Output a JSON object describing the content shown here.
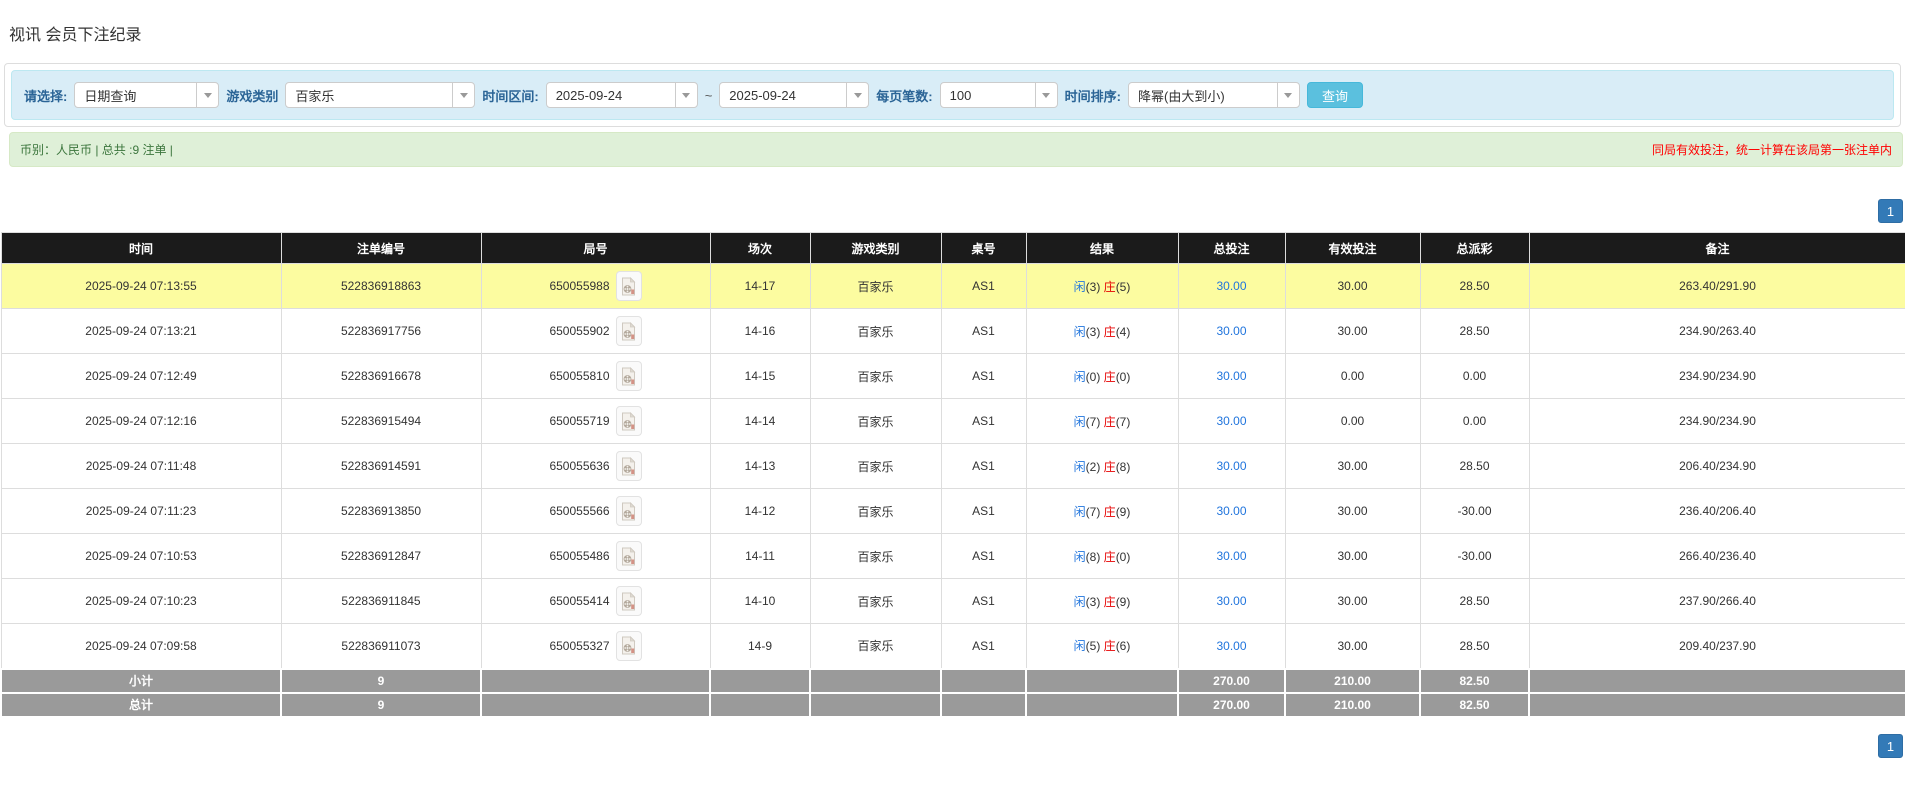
{
  "page": {
    "title": "视讯 会员下注纪录"
  },
  "filters": {
    "select_label": "请选择:",
    "select_value": "日期查询",
    "game_type_label": "游戏类别",
    "game_type_value": "百家乐",
    "time_range_label": "时间区间:",
    "date_from": "2025-09-24",
    "range_separator": "~",
    "date_to": "2025-09-24",
    "page_size_label": "每页笔数:",
    "page_size_value": "100",
    "sort_label": "时间排序:",
    "sort_value": "降幂(由大到小)",
    "search_button": "查询"
  },
  "summary": {
    "left_text": "币别：人民币 | 总共 :9 注单 |",
    "right_notice": "同局有效投注，统一计算在该局第一张注单内"
  },
  "pagination": {
    "page": "1"
  },
  "colors": {
    "link_blue": "#2175dd",
    "negative_red": "#e60000",
    "highlight_yellow": "#fcfca0",
    "header_bg": "#1b1b1b",
    "pager_blue": "#337ab7"
  },
  "table": {
    "headers": [
      "时间",
      "注单编号",
      "局号",
      "场次",
      "游戏类别",
      "桌号",
      "结果",
      "总投注",
      "有效投注",
      "总派彩",
      "备注"
    ],
    "rows": [
      {
        "highlight": true,
        "time": "2025-09-24 07:13:55",
        "bet_id": "522836918863",
        "round_id": "650055988",
        "session": "14-17",
        "game": "百家乐",
        "table": "AS1",
        "result": {
          "player_label": "闲",
          "player_count": "(3)",
          "banker_label": "庄",
          "banker_count": "(5)"
        },
        "total_bet": "30.00",
        "valid_bet": "30.00",
        "payout": "28.50",
        "payout_negative": false,
        "remark": "263.40/291.90"
      },
      {
        "highlight": false,
        "time": "2025-09-24 07:13:21",
        "bet_id": "522836917756",
        "round_id": "650055902",
        "session": "14-16",
        "game": "百家乐",
        "table": "AS1",
        "result": {
          "player_label": "闲",
          "player_count": "(3)",
          "banker_label": "庄",
          "banker_count": "(4)"
        },
        "total_bet": "30.00",
        "valid_bet": "30.00",
        "payout": "28.50",
        "payout_negative": false,
        "remark": "234.90/263.40"
      },
      {
        "highlight": false,
        "time": "2025-09-24 07:12:49",
        "bet_id": "522836916678",
        "round_id": "650055810",
        "session": "14-15",
        "game": "百家乐",
        "table": "AS1",
        "result": {
          "player_label": "闲",
          "player_count": "(0)",
          "banker_label": "庄",
          "banker_count": "(0)"
        },
        "total_bet": "30.00",
        "valid_bet": "0.00",
        "payout": "0.00",
        "payout_negative": false,
        "remark": "234.90/234.90"
      },
      {
        "highlight": false,
        "time": "2025-09-24 07:12:16",
        "bet_id": "522836915494",
        "round_id": "650055719",
        "session": "14-14",
        "game": "百家乐",
        "table": "AS1",
        "result": {
          "player_label": "闲",
          "player_count": "(7)",
          "banker_label": "庄",
          "banker_count": "(7)"
        },
        "total_bet": "30.00",
        "valid_bet": "0.00",
        "payout": "0.00",
        "payout_negative": false,
        "remark": "234.90/234.90"
      },
      {
        "highlight": false,
        "time": "2025-09-24 07:11:48",
        "bet_id": "522836914591",
        "round_id": "650055636",
        "session": "14-13",
        "game": "百家乐",
        "table": "AS1",
        "result": {
          "player_label": "闲",
          "player_count": "(2)",
          "banker_label": "庄",
          "banker_count": "(8)"
        },
        "total_bet": "30.00",
        "valid_bet": "30.00",
        "payout": "28.50",
        "payout_negative": false,
        "remark": "206.40/234.90"
      },
      {
        "highlight": false,
        "time": "2025-09-24 07:11:23",
        "bet_id": "522836913850",
        "round_id": "650055566",
        "session": "14-12",
        "game": "百家乐",
        "table": "AS1",
        "result": {
          "player_label": "闲",
          "player_count": "(7)",
          "banker_label": "庄",
          "banker_count": "(9)"
        },
        "total_bet": "30.00",
        "valid_bet": "30.00",
        "payout": "-30.00",
        "payout_negative": true,
        "remark": "236.40/206.40"
      },
      {
        "highlight": false,
        "time": "2025-09-24 07:10:53",
        "bet_id": "522836912847",
        "round_id": "650055486",
        "session": "14-11",
        "game": "百家乐",
        "table": "AS1",
        "result": {
          "player_label": "闲",
          "player_count": "(8)",
          "banker_label": "庄",
          "banker_count": "(0)"
        },
        "total_bet": "30.00",
        "valid_bet": "30.00",
        "payout": "-30.00",
        "payout_negative": true,
        "remark": "266.40/236.40"
      },
      {
        "highlight": false,
        "time": "2025-09-24 07:10:23",
        "bet_id": "522836911845",
        "round_id": "650055414",
        "session": "14-10",
        "game": "百家乐",
        "table": "AS1",
        "result": {
          "player_label": "闲",
          "player_count": "(3)",
          "banker_label": "庄",
          "banker_count": "(9)"
        },
        "total_bet": "30.00",
        "valid_bet": "30.00",
        "payout": "28.50",
        "payout_negative": false,
        "remark": "237.90/266.40"
      },
      {
        "highlight": false,
        "time": "2025-09-24 07:09:58",
        "bet_id": "522836911073",
        "round_id": "650055327",
        "session": "14-9",
        "game": "百家乐",
        "table": "AS1",
        "result": {
          "player_label": "闲",
          "player_count": "(5)",
          "banker_label": "庄",
          "banker_count": "(6)"
        },
        "total_bet": "30.00",
        "valid_bet": "30.00",
        "payout": "28.50",
        "payout_negative": false,
        "remark": "209.40/237.90"
      }
    ],
    "footer_rows": [
      {
        "cells": [
          "小计",
          "9",
          "",
          "",
          "",
          "",
          "",
          "270.00",
          "210.00",
          "82.50",
          ""
        ]
      },
      {
        "cells": [
          "总计",
          "9",
          "",
          "",
          "",
          "",
          "",
          "270.00",
          "210.00",
          "82.50",
          ""
        ]
      }
    ]
  }
}
